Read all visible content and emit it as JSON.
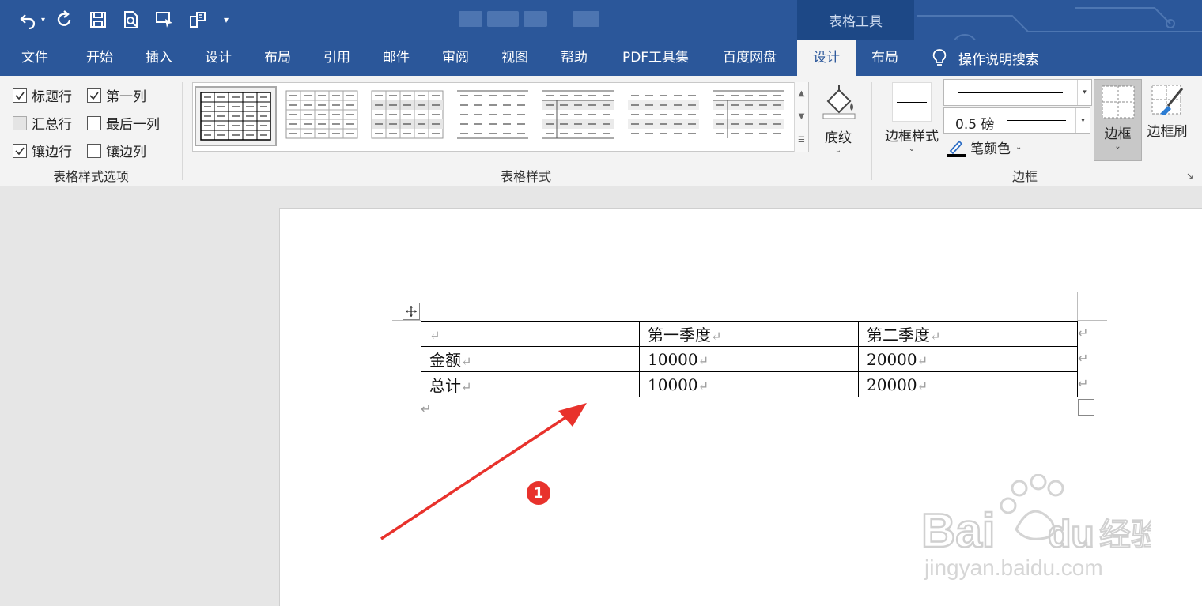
{
  "title_bar": {
    "context_title": "表格工具"
  },
  "tabs": [
    "文件",
    "开始",
    "插入",
    "设计",
    "布局",
    "引用",
    "邮件",
    "审阅",
    "视图",
    "帮助",
    "PDF工具集",
    "百度网盘",
    "设计",
    "布局"
  ],
  "active_tab_index": 12,
  "tell_me": "操作说明搜索",
  "style_options": {
    "label": "表格样式选项",
    "items": [
      {
        "label": "标题行",
        "checked": true
      },
      {
        "label": "第一列",
        "checked": true
      },
      {
        "label": "汇总行",
        "checked": false,
        "disabled": true
      },
      {
        "label": "最后一列",
        "checked": false
      },
      {
        "label": "镶边行",
        "checked": true
      },
      {
        "label": "镶边列",
        "checked": false
      }
    ]
  },
  "table_styles": {
    "label": "表格样式"
  },
  "shading": {
    "label": "底纹"
  },
  "borders": {
    "label": "边框",
    "border_styles_label": "边框样式",
    "weight": "0.5 磅",
    "pen_color": "笔颜色",
    "borders_button": "边框",
    "border_painter": "边框刷"
  },
  "document": {
    "table": [
      [
        "",
        "第一季度",
        "第二季度"
      ],
      [
        "金额",
        "10000",
        "20000"
      ],
      [
        "总计",
        "10000",
        "20000"
      ]
    ],
    "paragraph_mark": "↵"
  },
  "annotation": {
    "badge": "1",
    "color": "#e8322c"
  },
  "watermark": {
    "brand": "Bai du 经验",
    "url": "jingyan.baidu.com"
  },
  "colors": {
    "ribbon_blue": "#2b579a",
    "context_dark": "#1d4886"
  }
}
